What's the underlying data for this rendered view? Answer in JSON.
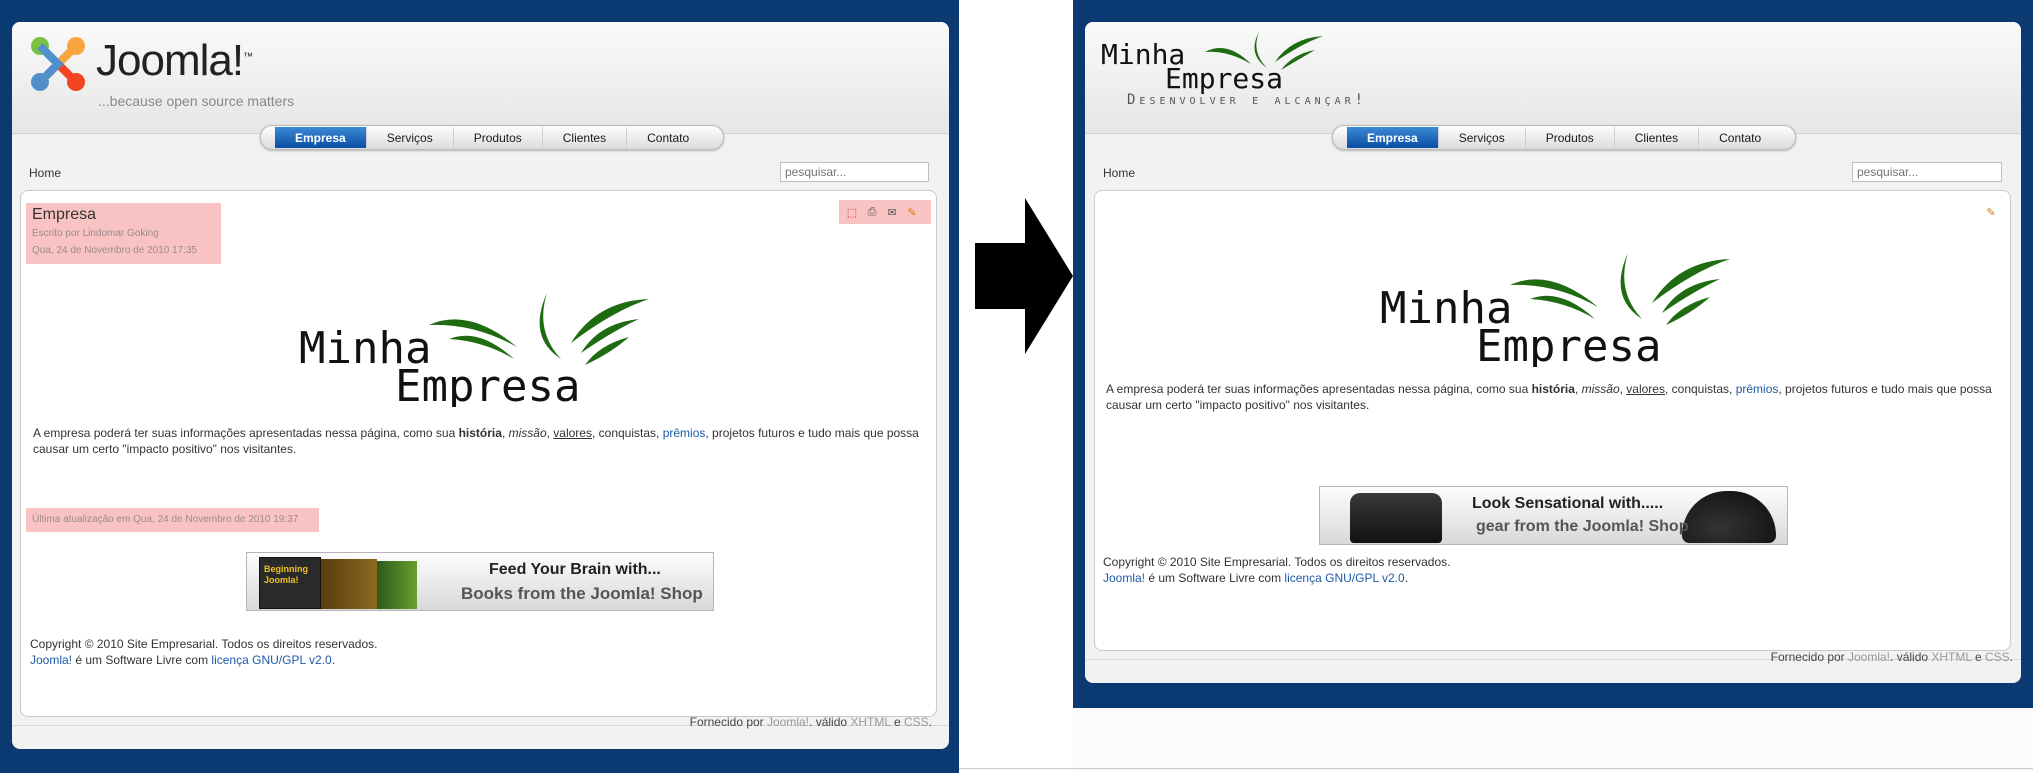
{
  "left": {
    "logo": {
      "brand": "Joomla!",
      "tm": "™",
      "tagline": "...because open source matters"
    },
    "nav": [
      "Empresa",
      "Serviços",
      "Produtos",
      "Clientes",
      "Contato"
    ],
    "breadcrumb": "Home",
    "search_placeholder": "pesquisar...",
    "article": {
      "title": "Empresa",
      "author": "Escrito por Lindomar Goking",
      "date": "Qua, 24 de Novembro de 2010 17:35",
      "logo_line1": "Minha",
      "logo_line2": "Empresa",
      "updated": "Última atualização em Qua, 24 de Novembro de 2010 19:37"
    },
    "icons": [
      "pdf-icon",
      "print-icon",
      "email-icon",
      "edit-icon"
    ],
    "banner": {
      "line1": "Feed Your Brain with...",
      "line2": "Books from the Joomla! Shop",
      "cover_title": "Beginning Joomla!"
    }
  },
  "right": {
    "logo": {
      "line1": "Minha",
      "line2": "Empresa",
      "tagline": "Desenvolver e alcançar!"
    },
    "nav": [
      "Empresa",
      "Serviços",
      "Produtos",
      "Clientes",
      "Contato"
    ],
    "breadcrumb": "Home",
    "search_placeholder": "pesquisar...",
    "article": {
      "logo_line1": "Minha",
      "logo_line2": "Empresa"
    },
    "icons": [
      "edit-icon"
    ],
    "banner": {
      "line1": "Look Sensational with.....",
      "line2": "gear from the Joomla! Shop"
    }
  },
  "body": {
    "p1_start": "A empresa poderá ter suas informações apresentadas nessa página, como sua ",
    "historia": "história",
    "sep1": ", ",
    "missao": "missão",
    "sep2": ", ",
    "valores": "valores",
    "mid": ", conquistas, ",
    "premios": "prêmios",
    "p1_end": ", projetos futuros e tudo mais que possa causar um certo \"impacto positivo\" nos visitantes."
  },
  "footer": {
    "copyright": "Copyright © 2010 Site Empresarial. Todos os direitos reservados.",
    "joomla_link": "Joomla!",
    "license_mid": " é um Software Livre com ",
    "license_link": "licença GNU/GPL v2.0",
    "license_end": ".",
    "powered_prefix": "Fornecido por ",
    "powered_joomla": "Joomla!",
    "powered_mid": ". válido ",
    "powered_xhtml": "XHTML",
    "powered_and": " e ",
    "powered_css": "CSS",
    "powered_end": "."
  },
  "colors": {
    "page_blue": "#0b3a72",
    "nav_active": "#0b4ea2",
    "highlight": "#f9c3c3",
    "link": "#1d5aa8",
    "leaf_green": "#1f6b12"
  }
}
